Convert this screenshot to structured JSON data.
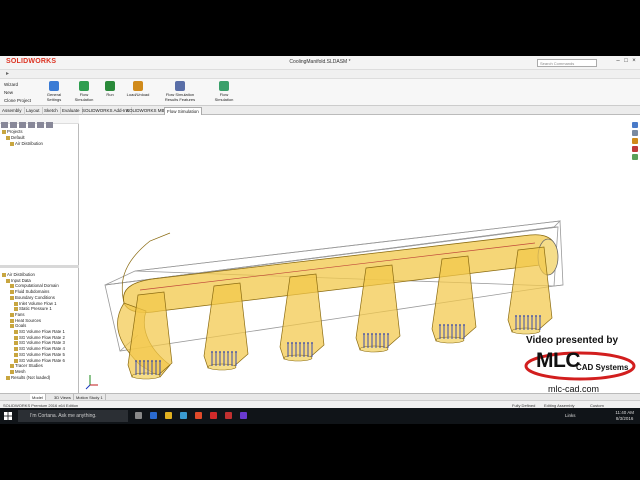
{
  "app": {
    "logo_text": "SOLIDWORKS",
    "document_title": "CoolingManifold.SLDASM *",
    "search_placeholder": "Search Commands",
    "window_controls": [
      "–",
      "□",
      "×"
    ]
  },
  "ribbon": {
    "left_items": [
      "Wizard",
      "New",
      "Clone Project"
    ],
    "tools": [
      {
        "label": "General Settings",
        "color": "#3a7bd5"
      },
      {
        "label": "Flow Simulation",
        "color": "#2e9e4f"
      },
      {
        "label": "Run",
        "color": "#2a8a3a"
      },
      {
        "label": "Load/Unload",
        "color": "#d08a1a"
      },
      {
        "label": "Flow Simulation Results Features",
        "color": "#5a6fa8"
      },
      {
        "label": "Flow Simulation",
        "color": "#3aa06a"
      }
    ]
  },
  "command_tabs": [
    "Assembly",
    "Layout",
    "Sketch",
    "Evaluate",
    "SOLIDWORKS Add-Ins",
    "SOLIDWORKS MBD",
    "Flow Simulation"
  ],
  "active_tab": "Flow Simulation",
  "tree_top": [
    "Projects",
    "Default",
    "Air Distribution"
  ],
  "tree_bottom": [
    "Air Distribution",
    "Input Data",
    "Computational Domain",
    "Fluid Subdomains",
    "Boundary Conditions",
    "Inlet Volume Flow 1",
    "Static Pressure 1",
    "Fans",
    "Heat Sources",
    "Goals",
    "SG Volume Flow Rate 1",
    "SG Volume Flow Rate 2",
    "SG Volume Flow Rate 3",
    "SG Volume Flow Rate 4",
    "SG Volume Flow Rate 5",
    "SG Volume Flow Rate 6",
    "Tracer Studies",
    "Mesh",
    "Results (Not loaded)"
  ],
  "bottom_tabs": [
    "Model",
    "3D Views",
    "Motion Study 1"
  ],
  "status_bar": {
    "edition": "SOLIDWORKS Premium 2016 x64 Edition",
    "state": "Fully Defined",
    "mode": "Editing Assembly",
    "units": "Custom"
  },
  "taskbar": {
    "cortana": "I'm Cortana. Ask me anything.",
    "links": "Links",
    "time": "11:40 AM",
    "date": "8/3/2016"
  },
  "branding": {
    "line1": "Video presented by",
    "company": "MLC",
    "subtitle": "CAD Systems",
    "url": "mlc-cad.com"
  },
  "colors": {
    "part_fill": "#f2c84a",
    "part_edge": "#8a6a10",
    "vector_blue": "#2a3fb0",
    "brand_red": "#d21e1e"
  }
}
